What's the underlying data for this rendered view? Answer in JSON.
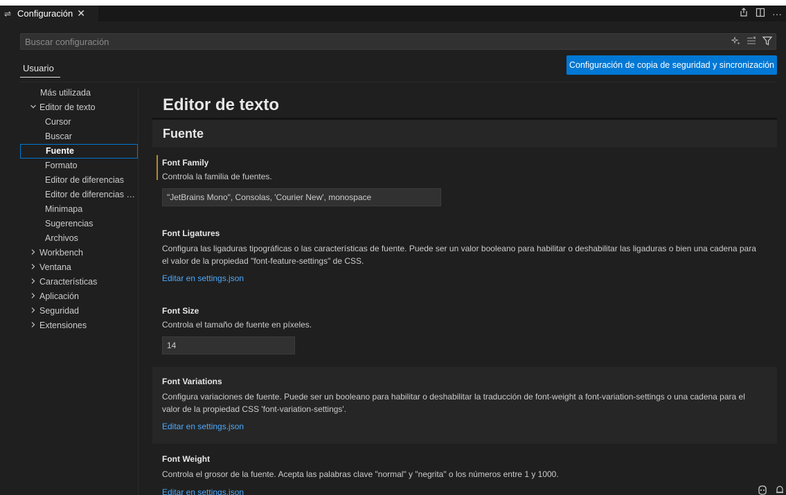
{
  "tab": {
    "icon": "settings-sliders-icon",
    "label": "Configuración",
    "close": "✕"
  },
  "tab_actions": [
    {
      "name": "open-json-icon",
      "glyph": "⎘"
    },
    {
      "name": "split-editor-icon",
      "glyph": "◫"
    },
    {
      "name": "more-actions-icon",
      "glyph": "···"
    }
  ],
  "search": {
    "placeholder": "Buscar configuración",
    "value": ""
  },
  "scope": {
    "user_tab": "Usuario"
  },
  "sync_button": "Configuración de copia de seguridad y sincronización",
  "toc": [
    {
      "label": "Más utilizada",
      "level": "top"
    },
    {
      "label": "Editor de texto",
      "level": "l0",
      "chevron": "expanded"
    },
    {
      "label": "Cursor",
      "level": "l1"
    },
    {
      "label": "Buscar",
      "level": "l1"
    },
    {
      "label": "Fuente",
      "level": "l1",
      "selected": true
    },
    {
      "label": "Formato",
      "level": "l1"
    },
    {
      "label": "Editor de diferencias",
      "level": "l1"
    },
    {
      "label": "Editor de diferencias d...",
      "level": "l1"
    },
    {
      "label": "Minimapa",
      "level": "l1"
    },
    {
      "label": "Sugerencias",
      "level": "l1"
    },
    {
      "label": "Archivos",
      "level": "l1"
    },
    {
      "label": "Workbench",
      "level": "l0",
      "chevron": "collapsed"
    },
    {
      "label": "Ventana",
      "level": "l0",
      "chevron": "collapsed"
    },
    {
      "label": "Características",
      "level": "l0",
      "chevron": "collapsed"
    },
    {
      "label": "Aplicación",
      "level": "l0",
      "chevron": "collapsed"
    },
    {
      "label": "Seguridad",
      "level": "l0",
      "chevron": "collapsed"
    },
    {
      "label": "Extensiones",
      "level": "l0",
      "chevron": "collapsed"
    }
  ],
  "content": {
    "section_title": "Editor de texto",
    "subsection_title": "Fuente",
    "settings": {
      "font_family": {
        "title": "Font Family",
        "description": "Controla la familia de fuentes.",
        "value": "\"JetBrains Mono\", Consolas, 'Courier New', monospace"
      },
      "font_ligatures": {
        "title": "Font Ligatures",
        "description": "Configura las ligaduras tipográficas o las características de fuente. Puede ser un valor booleano para habilitar o deshabilitar las ligaduras o bien una cadena para el valor de la propiedad \"font-feature-settings\" de CSS.",
        "link": "Editar en settings.json"
      },
      "font_size": {
        "title": "Font Size",
        "description": "Controla el tamaño de fuente en píxeles.",
        "value": "14"
      },
      "font_variations": {
        "title": "Font Variations",
        "description": "Configura variaciones de fuente. Puede ser un booleano para habilitar o deshabilitar la traducción de font-weight a font-variation-settings o una cadena para el valor de la propiedad CSS 'font-variation-settings'.",
        "link": "Editar en settings.json"
      },
      "font_weight": {
        "title": "Font Weight",
        "description": "Controla el grosor de la fuente. Acepta las palabras clave \"normal\" y \"negrita\" o los números entre 1 y 1000.",
        "link": "Editar en settings.json"
      }
    }
  },
  "status_icons": [
    {
      "name": "copilot-icon",
      "glyph": "☺"
    },
    {
      "name": "notifications-bell-icon",
      "glyph": "🔔︎"
    }
  ]
}
